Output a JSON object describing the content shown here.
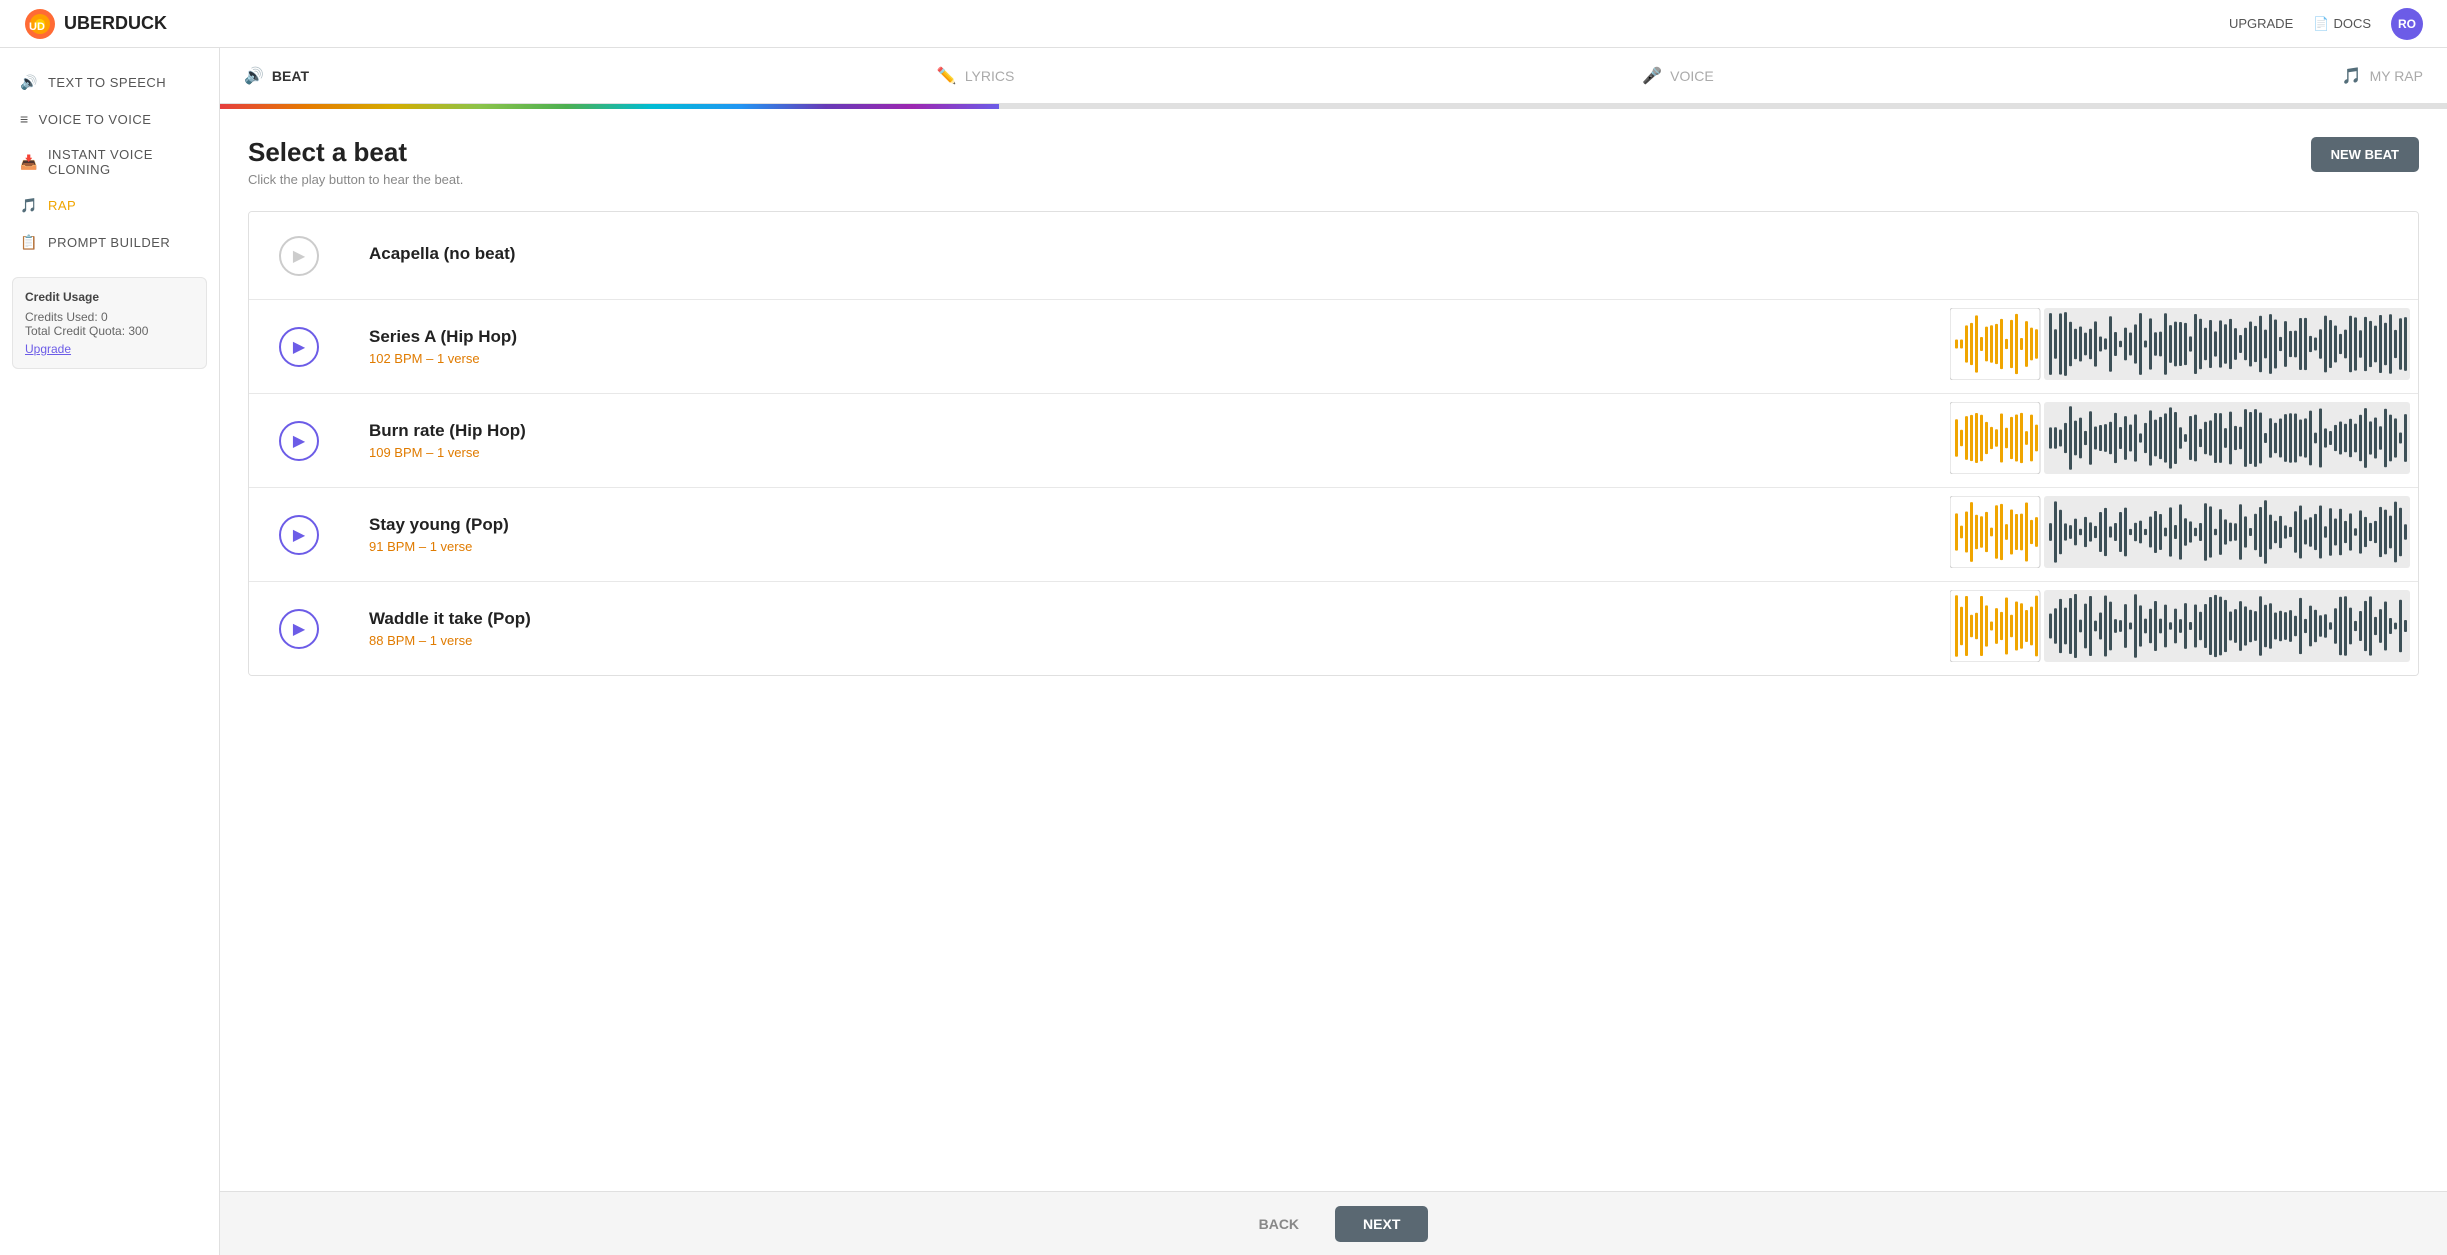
{
  "header": {
    "logo_text": "UBERDUCK",
    "upgrade_label": "UPGRADE",
    "docs_label": "DOCS",
    "avatar_initials": "RO"
  },
  "sidebar": {
    "items": [
      {
        "id": "text-to-speech",
        "label": "TEXT TO SPEECH",
        "icon": "🔊",
        "active": false
      },
      {
        "id": "voice-to-voice",
        "label": "VOICE TO VOICE",
        "icon": "≡",
        "active": false
      },
      {
        "id": "instant-voice-cloning",
        "label": "INSTANT VOICE CLONING",
        "icon": "📥",
        "active": false
      },
      {
        "id": "rap",
        "label": "RAP",
        "icon": "🎵",
        "active": true
      },
      {
        "id": "prompt-builder",
        "label": "PROMPT BUILDER",
        "icon": "📋",
        "active": false
      }
    ],
    "credit_usage": {
      "title": "Credit Usage",
      "credits_used_label": "Credits Used: 0",
      "total_quota_label": "Total Credit Quota: 300",
      "upgrade_label": "Upgrade"
    }
  },
  "steps": [
    {
      "id": "beat",
      "label": "BEAT",
      "icon": "🔊",
      "active": true
    },
    {
      "id": "lyrics",
      "label": "LYRICS",
      "icon": "✏️",
      "active": false
    },
    {
      "id": "voice",
      "label": "VOICE",
      "icon": "🎤",
      "active": false
    },
    {
      "id": "my-rap",
      "label": "MY RAP",
      "icon": "🎵",
      "active": false
    }
  ],
  "progress_percent": 35,
  "content": {
    "title": "Select a beat",
    "subtitle": "Click the play button to hear the beat.",
    "new_beat_label": "NEW BEAT"
  },
  "beats": [
    {
      "id": "acapella",
      "name": "Acapella (no beat)",
      "bpm": null,
      "verses": null,
      "has_wave": false
    },
    {
      "id": "series-a",
      "name": "Series A (Hip Hop)",
      "bpm": "102 BPM",
      "separator": "–",
      "verses": "1 verse",
      "has_wave": true
    },
    {
      "id": "burn-rate",
      "name": "Burn rate (Hip Hop)",
      "bpm": "109 BPM",
      "separator": "–",
      "verses": "1 verse",
      "has_wave": true
    },
    {
      "id": "stay-young",
      "name": "Stay young (Pop)",
      "bpm": "91 BPM",
      "separator": "–",
      "verses": "1 verse",
      "has_wave": true
    },
    {
      "id": "waddle-it-take",
      "name": "Waddle it take (Pop)",
      "bpm": "88 BPM",
      "separator": "–",
      "verses": "1 verse",
      "has_wave": true
    }
  ],
  "footer": {
    "back_label": "BACK",
    "next_label": "NEXT"
  }
}
